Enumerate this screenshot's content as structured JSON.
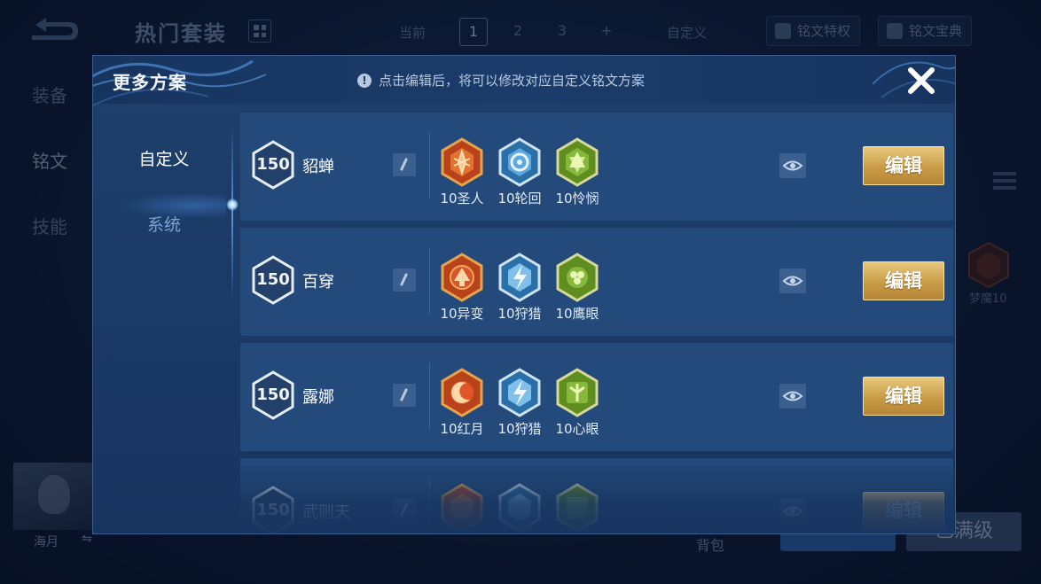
{
  "background": {
    "title": "热门套装",
    "current_label": "当前",
    "pages": [
      "1",
      "2",
      "3",
      "+"
    ],
    "custom_label": "自定义",
    "privilege_label": "铭文特权",
    "guide_label": "铭文宝典",
    "side_menu": [
      "装备",
      "铭文",
      "技能"
    ],
    "hero_name": "海月",
    "swap_icon": "⇋",
    "bag_label": "背包",
    "maxed_label": "已满级",
    "side_badge_label": "梦魔10"
  },
  "modal": {
    "title": "更多方案",
    "notice": "点击编辑后，将可以修改对应自定义铭文方案",
    "notice_icon": "!",
    "tabs": [
      "自定义",
      "系统"
    ],
    "edit_label": "编辑",
    "rows": [
      {
        "level": "150",
        "name": "貂蝉",
        "inscriptions": [
          {
            "label": "10圣人",
            "color": "red",
            "icon": "saint-icon"
          },
          {
            "label": "10轮回",
            "color": "blue",
            "icon": "samsara-icon"
          },
          {
            "label": "10怜悯",
            "color": "green",
            "icon": "mercy-icon"
          }
        ]
      },
      {
        "level": "150",
        "name": "百穿",
        "inscriptions": [
          {
            "label": "10异变",
            "color": "red",
            "icon": "mutation-icon"
          },
          {
            "label": "10狩猎",
            "color": "blue",
            "icon": "hunt-icon"
          },
          {
            "label": "10鹰眼",
            "color": "green",
            "icon": "hawkeye-icon"
          }
        ]
      },
      {
        "level": "150",
        "name": "露娜",
        "inscriptions": [
          {
            "label": "10红月",
            "color": "red",
            "icon": "red-moon-icon"
          },
          {
            "label": "10狩猎",
            "color": "blue",
            "icon": "hunt-icon"
          },
          {
            "label": "10心眼",
            "color": "green",
            "icon": "mind-eye-icon"
          }
        ]
      },
      {
        "level": "150",
        "name": "武则天",
        "inscriptions": [
          {
            "label": "",
            "color": "red",
            "icon": "saint-icon"
          },
          {
            "label": "",
            "color": "blue",
            "icon": "hunt-icon"
          },
          {
            "label": "",
            "color": "green",
            "icon": "mind-eye-icon"
          }
        ]
      }
    ]
  },
  "colors": {
    "accent_gold": "#d9b565",
    "panel_blue": "#234a7a",
    "red_gem": "#c8431c",
    "blue_gem": "#3f8ec9",
    "green_gem": "#6b9a2a"
  }
}
